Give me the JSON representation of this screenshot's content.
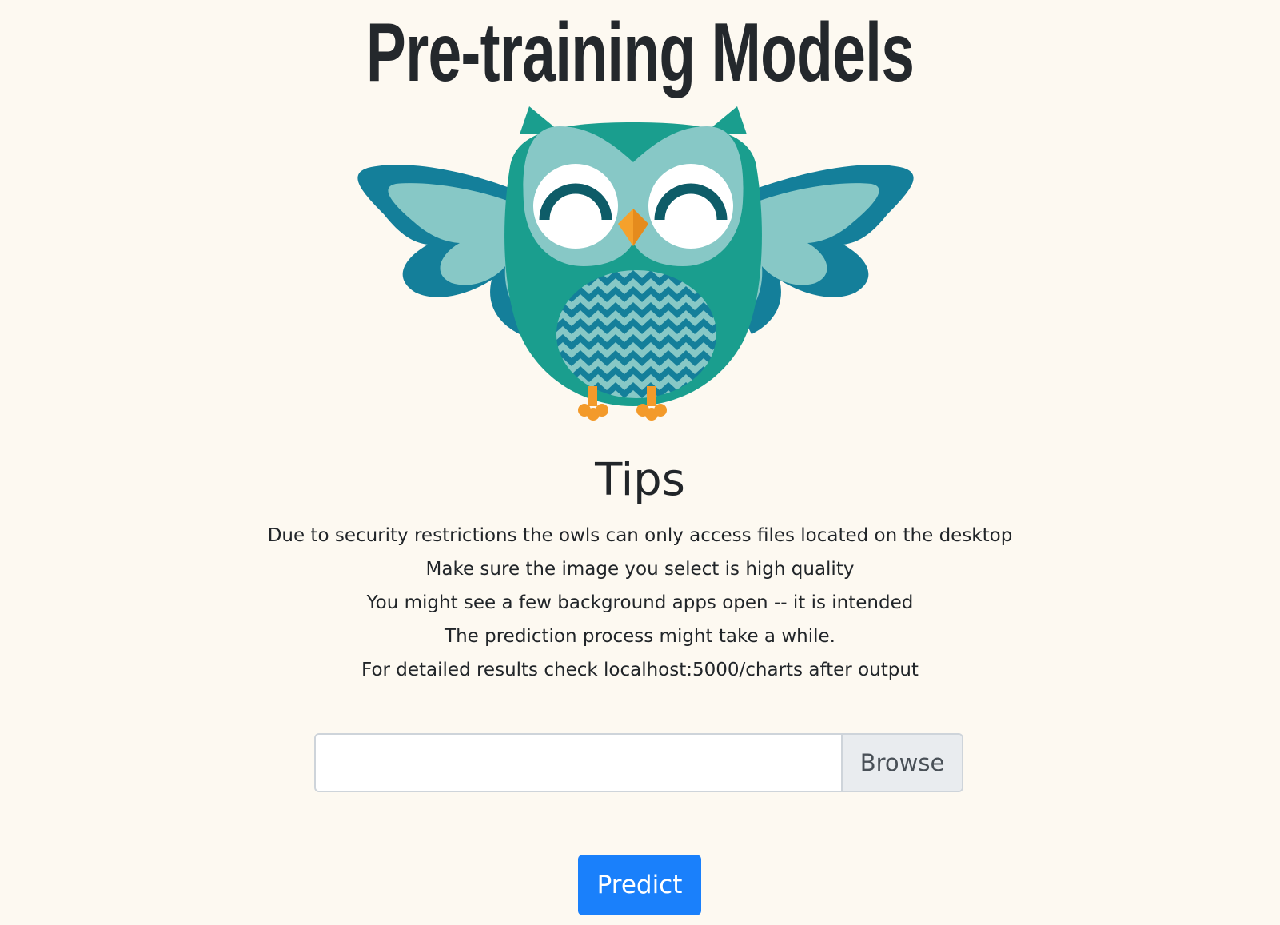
{
  "header": {
    "title": "Pre-training Models"
  },
  "illustration": {
    "icon": "owl-illustration",
    "colors": {
      "body": "#1a9e8e",
      "face": "#87c8c6",
      "wing_outer": "#147f9a",
      "wing_inner": "#87c8c6",
      "eye_arc": "#0e5c68",
      "beak": "#f5a12c",
      "feet": "#f39a2a"
    }
  },
  "tips": {
    "heading": "Tips",
    "items": [
      "Due to security restrictions the owls can only access files located on the desktop",
      "Make sure the image you select is high quality",
      "You might see a few background apps open -- it is intended",
      "The prediction process might take a while.",
      "For detailed results check localhost:5000/charts after output"
    ]
  },
  "file_picker": {
    "value": "",
    "browse_label": "Browse"
  },
  "actions": {
    "predict_label": "Predict"
  },
  "colors": {
    "background": "#fdf9f1",
    "primary": "#1a80fb",
    "input_border": "#ced4da",
    "browse_bg": "#e9ecef"
  }
}
